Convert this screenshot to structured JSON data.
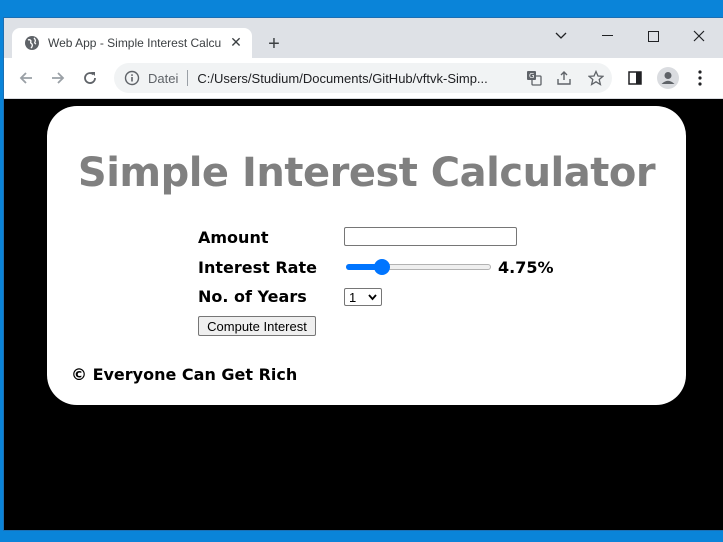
{
  "browser": {
    "tab_title": "Web App - Simple Interest Calcul",
    "address_prefix": "Datei",
    "url": "C:/Users/Studium/Documents/GitHub/vftvk-Simp..."
  },
  "page": {
    "heading": "Simple Interest Calculator",
    "amount": {
      "label": "Amount",
      "value": ""
    },
    "rate": {
      "label": "Interest Rate",
      "display": "4.75%",
      "slider_fraction": 0.22
    },
    "years": {
      "label": "No. of Years",
      "selected": "1"
    },
    "compute_button": "Compute Interest",
    "footer": "© Everyone Can Get Rich"
  },
  "colors": {
    "heading": "#808080",
    "accent": "#0075ff",
    "page_background": "#000000",
    "desktop": "#0a84d9"
  }
}
